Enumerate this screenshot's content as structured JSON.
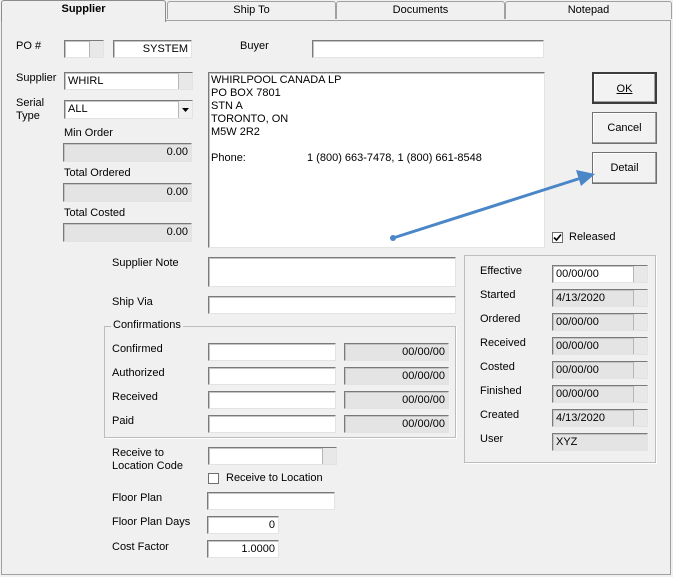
{
  "tabs": [
    {
      "label": "Supplier",
      "active": true
    },
    {
      "label": "Ship To",
      "active": false
    },
    {
      "label": "Documents",
      "active": false
    },
    {
      "label": "Notepad",
      "active": false
    }
  ],
  "po": {
    "label": "PO #",
    "number": "",
    "system": "SYSTEM"
  },
  "buyer": {
    "label": "Buyer",
    "value": ""
  },
  "supplier": {
    "label": "Supplier",
    "code": "WHIRL"
  },
  "serial_type": {
    "label_line1": "Serial",
    "label_line2": "Type",
    "value": "ALL"
  },
  "min_order": {
    "label": "Min Order",
    "value": "0.00"
  },
  "total_ordered": {
    "label": "Total Ordered",
    "value": "0.00"
  },
  "total_costed": {
    "label": "Total Costed",
    "value": "0.00"
  },
  "address": {
    "lines": [
      "WHIRLPOOL CANADA LP",
      "PO BOX 7801",
      "STN A",
      "TORONTO, ON",
      "M5W 2R2"
    ],
    "phone_label": "Phone:",
    "phone_value": "1 (800) 663-7478, 1 (800) 661-8548"
  },
  "buttons": {
    "ok": "OK",
    "cancel": "Cancel",
    "detail": "Detail"
  },
  "released": {
    "label": "Released",
    "checked": true
  },
  "supplier_note": {
    "label": "Supplier Note",
    "value": ""
  },
  "ship_via": {
    "label": "Ship Via",
    "value": ""
  },
  "confirmations": {
    "title": "Confirmations",
    "rows": [
      {
        "label": "Confirmed",
        "value": "",
        "date": "00/00/00"
      },
      {
        "label": "Authorized",
        "value": "",
        "date": "00/00/00"
      },
      {
        "label": "Received",
        "value": "",
        "date": "00/00/00"
      },
      {
        "label": "Paid",
        "value": "",
        "date": "00/00/00"
      }
    ]
  },
  "dates": [
    {
      "label": "Effective",
      "value": "00/00/00",
      "gray": false
    },
    {
      "label": "Started",
      "value": "4/13/2020",
      "gray": true
    },
    {
      "label": "Ordered",
      "value": "00/00/00",
      "gray": true
    },
    {
      "label": "Received",
      "value": "00/00/00",
      "gray": true
    },
    {
      "label": "Costed",
      "value": "00/00/00",
      "gray": true
    },
    {
      "label": "Finished",
      "value": "00/00/00",
      "gray": true
    },
    {
      "label": "Created",
      "value": "4/13/2020",
      "gray": true
    }
  ],
  "user": {
    "label": "User",
    "value": "XYZ"
  },
  "receive_location": {
    "label_line1": "Receive to",
    "label_line2": "Location Code",
    "value": "",
    "checkbox_label": "Receive to Location",
    "checked": false
  },
  "floor_plan": {
    "label": "Floor Plan",
    "value": ""
  },
  "floor_plan_days": {
    "label": "Floor Plan Days",
    "value": "0"
  },
  "cost_factor": {
    "label": "Cost Factor",
    "value": "1.0000"
  },
  "colors": {
    "arrow": "#4a86c8"
  }
}
